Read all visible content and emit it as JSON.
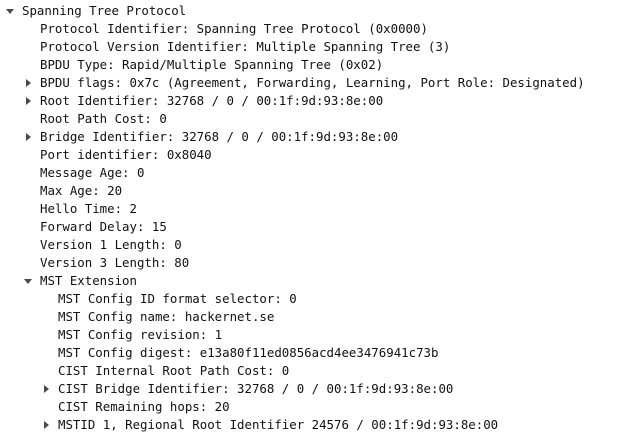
{
  "tree": {
    "root": {
      "label": "Spanning Tree Protocol",
      "expanded": true,
      "toggle_icon": "triangle-down-icon"
    },
    "items": [
      {
        "label": "Protocol Identifier: Spanning Tree Protocol (0x0000)"
      },
      {
        "label": "Protocol Version Identifier: Multiple Spanning Tree (3)"
      },
      {
        "label": "BPDU Type: Rapid/Multiple Spanning Tree (0x02)"
      },
      {
        "label": "BPDU flags: 0x7c (Agreement, Forwarding, Learning, Port Role: Designated)",
        "expandable": true
      },
      {
        "label": "Root Identifier: 32768 / 0 / 00:1f:9d:93:8e:00",
        "expandable": true
      },
      {
        "label": "Root Path Cost: 0"
      },
      {
        "label": "Bridge Identifier: 32768 / 0 / 00:1f:9d:93:8e:00",
        "expandable": true
      },
      {
        "label": "Port identifier: 0x8040"
      },
      {
        "label": "Message Age: 0"
      },
      {
        "label": "Max Age: 20"
      },
      {
        "label": "Hello Time: 2"
      },
      {
        "label": "Forward Delay: 15"
      },
      {
        "label": "Version 1 Length: 0"
      },
      {
        "label": "Version 3 Length: 80"
      },
      {
        "label": "MST Extension",
        "expanded": true
      }
    ],
    "mst_items": [
      {
        "label": "MST Config ID format selector: 0"
      },
      {
        "label": "MST Config name: hackernet.se"
      },
      {
        "label": "MST Config revision: 1"
      },
      {
        "label": "MST Config digest: e13a80f11ed0856acd4ee3476941c73b"
      },
      {
        "label": "CIST Internal Root Path Cost: 0"
      },
      {
        "label": "CIST Bridge Identifier: 32768 / 0 / 00:1f:9d:93:8e:00",
        "expandable": true
      },
      {
        "label": "CIST Remaining hops: 20"
      },
      {
        "label": "MSTID 1, Regional Root Identifier 24576 / 00:1f:9d:93:8e:00",
        "expandable": true
      }
    ]
  },
  "colors": {
    "text": "#111111",
    "toggle": "#4a4a4a",
    "background": "#ffffff"
  }
}
